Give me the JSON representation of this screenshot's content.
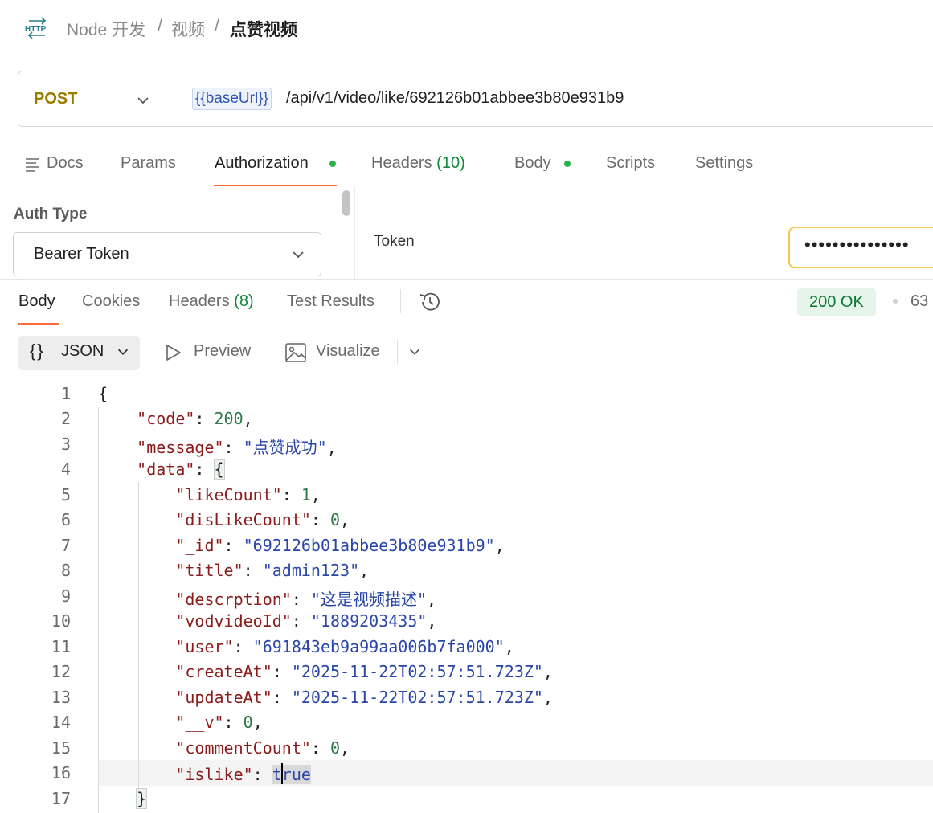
{
  "breadcrumb": {
    "icon": "http-icon",
    "workspace": "Node 开发",
    "folder": "视频",
    "request": "点赞视频",
    "separator": "/"
  },
  "request": {
    "method": "POST",
    "url_variable": "{{baseUrl}}",
    "url_path": "/api/v1/video/like/692126b01abbee3b80e931b9"
  },
  "request_tabs": [
    {
      "label": "Docs",
      "icon": "docs-icon"
    },
    {
      "label": "Params"
    },
    {
      "label": "Authorization",
      "active": true,
      "dot": true
    },
    {
      "label": "Headers",
      "count": "(10)"
    },
    {
      "label": "Body",
      "dot": true
    },
    {
      "label": "Scripts"
    },
    {
      "label": "Settings"
    }
  ],
  "auth": {
    "type_label": "Auth Type",
    "type_value": "Bearer Token",
    "token_label": "Token",
    "token_value": "•••••••••••••••"
  },
  "response_tabs": [
    {
      "label": "Body",
      "active": true
    },
    {
      "label": "Cookies"
    },
    {
      "label": "Headers",
      "count": "(8)"
    },
    {
      "label": "Test Results"
    }
  ],
  "response_status": {
    "status": "200 OK",
    "time_partial": "63"
  },
  "format_toolbar": {
    "format_icon": "{}",
    "format": "JSON",
    "preview": "Preview",
    "visualize": "Visualize"
  },
  "code_lines": [
    "1",
    "2",
    "3",
    "4",
    "5",
    "6",
    "7",
    "8",
    "9",
    "10",
    "11",
    "12",
    "13",
    "14",
    "15",
    "16",
    "17"
  ],
  "response_json": {
    "open_brace": "{",
    "close_brace": "}",
    "code_key": "\"code\"",
    "code_val": "200",
    "message_key": "\"message\"",
    "message_val": "\"点赞成功\"",
    "data_key": "\"data\"",
    "likeCount_key": "\"likeCount\"",
    "likeCount_val": "1",
    "disLikeCount_key": "\"disLikeCount\"",
    "disLikeCount_val": "0",
    "id_key": "\"_id\"",
    "id_val": "\"692126b01abbee3b80e931b9\"",
    "title_key": "\"title\"",
    "title_val": "\"admin123\"",
    "descrption_key": "\"descrption\"",
    "descrption_val": "\"这是视频描述\"",
    "vodvideoId_key": "\"vodvideoId\"",
    "vodvideoId_val": "\"1889203435\"",
    "user_key": "\"user\"",
    "user_val": "\"691843eb9a99aa006b7fa000\"",
    "createAt_key": "\"createAt\"",
    "createAt_val": "\"2025-11-22T02:57:51.723Z\"",
    "updateAt_key": "\"updateAt\"",
    "updateAt_val": "\"2025-11-22T02:57:51.723Z\"",
    "v_key": "\"__v\"",
    "v_val": "0",
    "commentCount_key": "\"commentCount\"",
    "commentCount_val": "0",
    "islike_key": "\"islike\"",
    "islike_val_a": "t",
    "islike_val_b": "rue"
  },
  "colors": {
    "accent": "#ff6c37",
    "method_post": "#9c7a00",
    "status_ok_bg": "#e6f5ea",
    "status_ok_text": "#0a7a32",
    "dot_green": "#2bb24c",
    "json_key": "#8b1c1c",
    "json_string": "#2946a8",
    "json_number": "#2f7a4a"
  }
}
